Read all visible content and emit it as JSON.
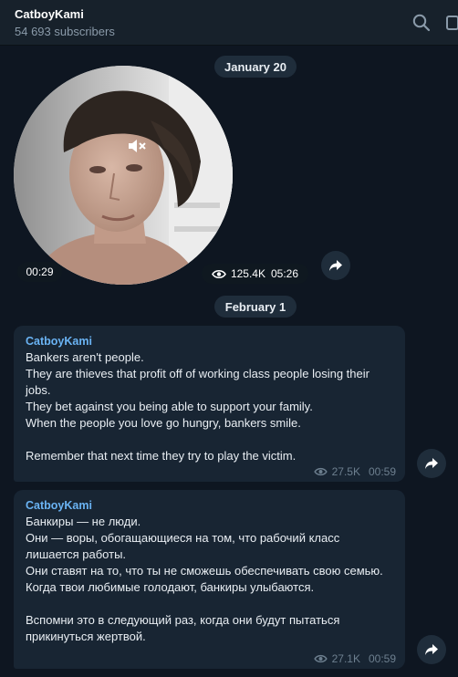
{
  "header": {
    "channel_name": "CatboyKami",
    "subscribers": "54 693 subscribers"
  },
  "icons": {
    "search": "search-icon",
    "more": "more-icon",
    "mute": "muted-speaker-icon",
    "eye": "eye-icon",
    "share": "share-arrow-icon"
  },
  "colors": {
    "background": "#0e1621",
    "header": "#17212b",
    "bubble": "#182533",
    "sender": "#6ab3f3",
    "meta": "#6d7f8f"
  },
  "video_message": {
    "date": "January 20",
    "duration": "00:29",
    "views": "125.4K",
    "time": "05:26"
  },
  "messages": [
    {
      "date": "February 1",
      "sender": "CatboyKami",
      "text": "Bankers aren't people.\nThey are thieves that profit off of working class people losing their jobs.\nThey bet against you being able to support your family.\nWhen the people you love go hungry, bankers smile.\n\nRemember that next time they try to play the victim.",
      "views": "27.5K",
      "time": "00:59"
    },
    {
      "sender": "CatboyKami",
      "text": "Банкиры — не люди.\nОни — воры, обогащающиеся на том, что рабочий класс лишается работы.\nОни ставят на то, что ты не сможешь обеспечивать свою семью.\nКогда твои любимые голодают, банкиры улыбаются.\n\nВспомни это в следующий раз, когда они будут пытаться прикинуться жертвой.",
      "views": "27.1K",
      "time": "00:59"
    }
  ]
}
